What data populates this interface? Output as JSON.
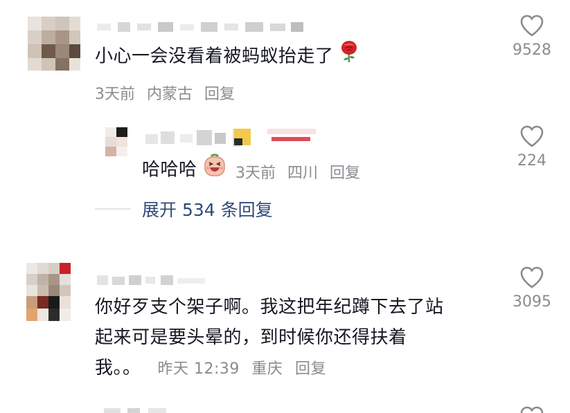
{
  "comments": [
    {
      "text": "小心一会没看着被蚂蚁抬走了",
      "emoji": "rose-emoji",
      "time": "3天前",
      "location": "内蒙古",
      "reply_label": "回复",
      "likes": "9528",
      "reply": {
        "text": "哈哈哈",
        "emoji": "laughing-face-emoji",
        "time": "3天前",
        "location": "四川",
        "reply_label": "回复",
        "likes": "224"
      },
      "expand_label": "展开 534 条回复"
    },
    {
      "lines": [
        "你好歹支个架子啊。我这把年纪蹲下去了站",
        "起来可是要头晕的，到时候你还得扶着",
        "我。。"
      ],
      "time": "昨天 12:39",
      "location": "重庆",
      "reply_label": "回复",
      "likes": "3095"
    }
  ],
  "icons": {
    "like": "heart-outline-icon"
  },
  "colors": {
    "text": "#161823",
    "meta": "#8a8b91",
    "expand": "#2e4a78"
  }
}
